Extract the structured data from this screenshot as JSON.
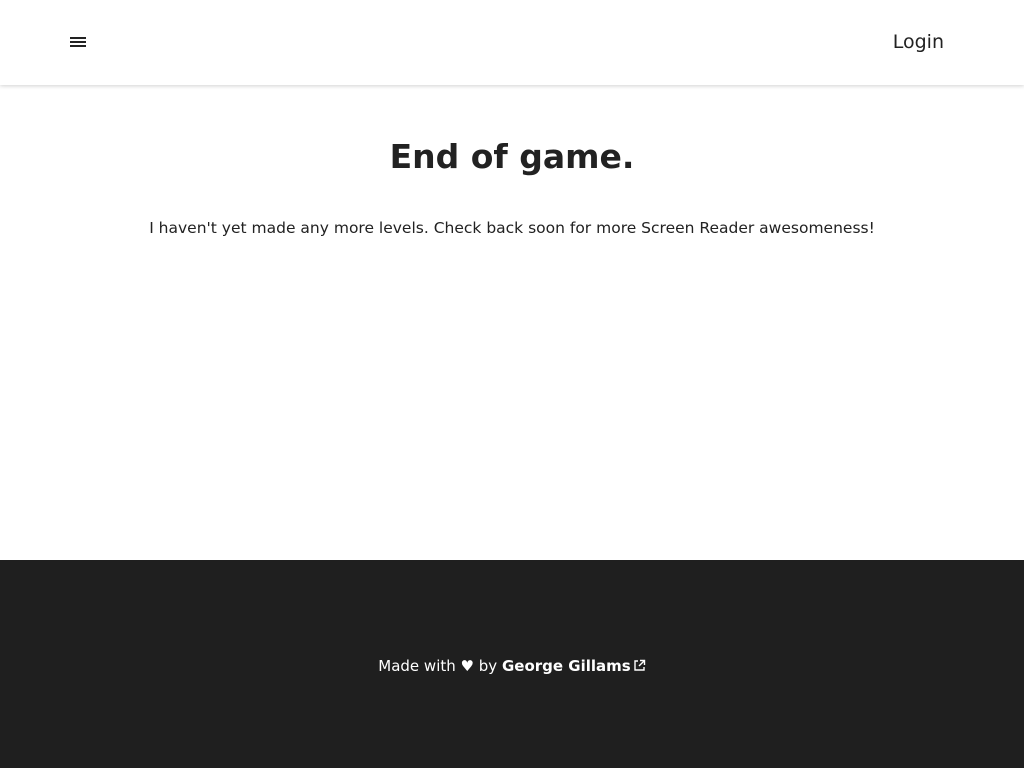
{
  "header": {
    "menu_icon": "hamburger-menu-icon",
    "login_label": "Login"
  },
  "main": {
    "title": "End of game.",
    "message": "I haven't yet made any more levels. Check back soon for more Screen Reader awesomeness!"
  },
  "footer": {
    "made_with": "Made with",
    "heart": "♥",
    "by": "by",
    "author": "George Gillams",
    "external_icon": "external-link-icon"
  },
  "colors": {
    "footer_bg": "#1f1f1f",
    "text": "#222222"
  }
}
